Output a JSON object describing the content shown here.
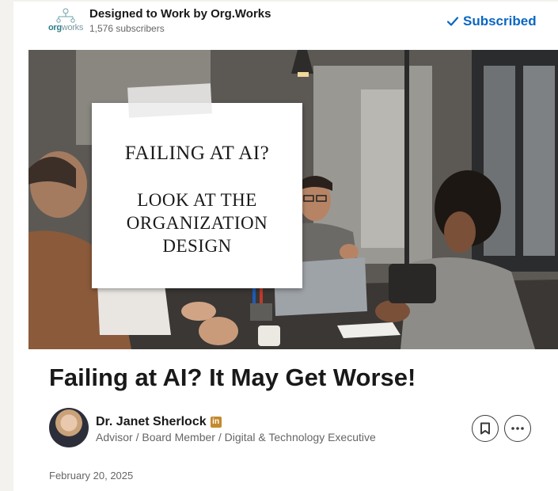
{
  "newsletter": {
    "logo_text_a": "org",
    "logo_text_b": "works",
    "title": "Designed to Work by Org.Works",
    "subscribers": "1,576 subscribers",
    "subscribe_state": "Subscribed",
    "accent_color": "#0a66c2"
  },
  "cover": {
    "line1": "FAILING AT AI?",
    "line2": "LOOK AT THE ORGANIZATION DESIGN"
  },
  "article": {
    "title": "Failing at AI? It May Get Worse!",
    "date": "February 20, 2025"
  },
  "author": {
    "name": "Dr. Janet Sherlock",
    "badge": "in",
    "headline": "Advisor / Board Member / Digital & Technology Executive"
  },
  "actions": {
    "save_icon": "bookmark-icon",
    "more_icon": "more-horizontal-icon"
  }
}
